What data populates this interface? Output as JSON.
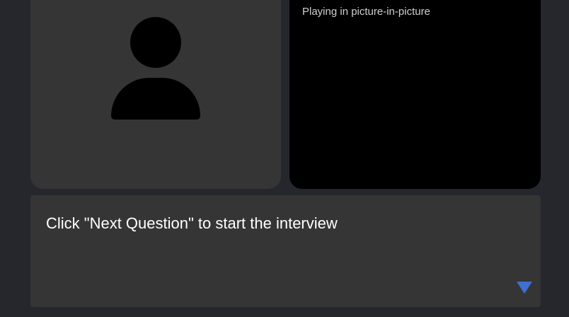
{
  "avatar": {
    "icon": "user-silhouette-icon"
  },
  "video": {
    "status_text": "Playing in picture-in-picture"
  },
  "question": {
    "text": "Click \"Next Question\" to start the interview",
    "expand_icon": "triangle-down-icon",
    "expand_color": "#3f6fd1"
  },
  "colors": {
    "background": "#25272d",
    "panel": "#353535",
    "video": "#000000"
  }
}
